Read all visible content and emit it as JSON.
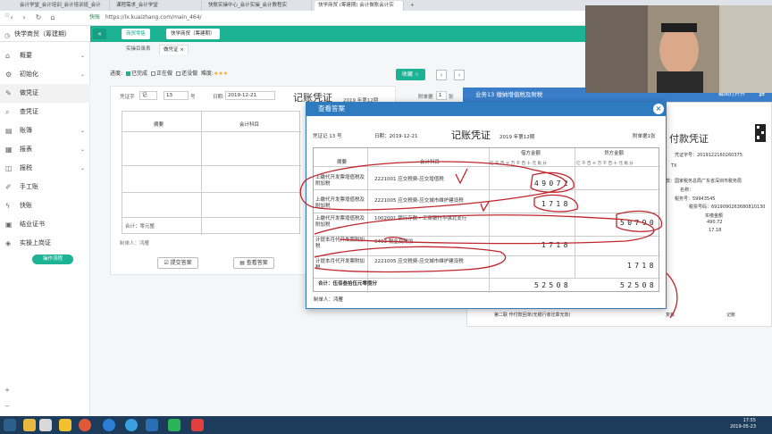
{
  "browser": {
    "tabs": [
      "会计学堂_会计培训_会计培训班_会计",
      "课程需求_会计学堂",
      "快账实操中心_会计实操_会计教程实",
      "快学商贸 (筹建期) 会计做账会计实",
      "+"
    ],
    "url_prefix": "快账",
    "url": "https://lx.kuaizhang.com/main_464/"
  },
  "header": {
    "logo": "快学商贸（筹建期）",
    "collapse": "«",
    "industry_btn": "商贸零售",
    "company_btn": "快学商贸（筹建期）",
    "right_link": "首页"
  },
  "sidebar": {
    "items": [
      {
        "label": "概要",
        "icon": "home-icon"
      },
      {
        "label": "初始化",
        "icon": "gear-icon"
      },
      {
        "label": "做凭证",
        "icon": "edit-icon"
      },
      {
        "label": "查凭证",
        "icon": "search-icon"
      },
      {
        "label": "账簿",
        "icon": "book-icon"
      },
      {
        "label": "报表",
        "icon": "chart-icon"
      },
      {
        "label": "报税",
        "icon": "tax-icon"
      },
      {
        "label": "手工账",
        "icon": "pen-icon"
      },
      {
        "label": "快账",
        "icon": "flash-icon"
      },
      {
        "label": "结业证书",
        "icon": "certificate-icon"
      },
      {
        "label": "实操上岗证",
        "icon": "badge-icon"
      }
    ],
    "operation_btn": "操作流程"
  },
  "subtabs": [
    "实操目录表",
    "做凭证",
    "×"
  ],
  "progress": {
    "label": "进度:",
    "done": "已完成",
    "doing": "正在做",
    "todo": "还没做",
    "difficulty": "难度:",
    "stars": "★★★"
  },
  "fav_btn": "收藏 ☆",
  "form": {
    "voucher_word_label": "凭证字",
    "voucher_word": "记",
    "voucher_no": "13",
    "no_label": "号",
    "date_label": "日期:",
    "date": "2019-12-21",
    "title": "记账凭证",
    "period": "2019 年第12期",
    "attach_label": "附单据",
    "attach_val": "1",
    "attach_unit": "张",
    "col_summary": "摘要",
    "col_account": "会计科目",
    "total": "合计：零元整",
    "maker": "制单人：鸿雁",
    "submit_btn": "提交答案",
    "view_btn": "查看答案"
  },
  "business": {
    "title": "业务13 缴纳增值税及附税",
    "right": "截图打开并"
  },
  "receipt": {
    "title": "付款凭证",
    "no": "凭证字号：2019122160260375",
    "l1": "TX",
    "l2": "款：国家税务总局广东省深圳市税务局",
    "l3": "名称：",
    "l4": "税务号：59943545",
    "l5": "税票号码：6919090263680810130",
    "l6": "实缴金额",
    "l7": "490.72",
    "l8": "17.18",
    "footer1": "第二联 作付款回单(无银行收讫章无效)",
    "footer2": "复核",
    "footer3": "记账"
  },
  "dialog": {
    "title": "查看答案",
    "close": "×",
    "voucher_no": "凭证记 13 号",
    "date": "日期：2019-12-21",
    "vtitle": "记账凭证",
    "period": "2019 年第12期",
    "attach": "附单据1张",
    "col_summary": "摘要",
    "col_account": "会计科目",
    "col_debit": "借方金额",
    "col_credit": "贷方金额",
    "digits": "亿 千 百 十 万 千 百 十 元 角 分",
    "rows": [
      {
        "summary": "上缴代开发票增值税及附加税",
        "account": "2221001 应交税费-应交增值税",
        "debit": "49072",
        "credit": ""
      },
      {
        "summary": "上缴代开发票增值税及附加税",
        "account": "2221005 应交税费-应交城市维护建设税",
        "debit": "1718",
        "credit": ""
      },
      {
        "summary": "上缴代开发票增值税及附加税",
        "account": "1002001 银行存款 - 工商银行华强北支行",
        "debit": "",
        "credit": "50790"
      },
      {
        "summary": "计提本月代开发票附加税",
        "account": "6403 税金及附加",
        "debit": "1718",
        "credit": ""
      },
      {
        "summary": "计提本月代开发票附加税",
        "account": "2221005 应交税费-应交城市维护建设税",
        "debit": "",
        "credit": "1718"
      }
    ],
    "total_label": "合计：伍佰叁拾伍元零捌分",
    "total_debit": "52508",
    "total_credit": "52508",
    "maker": "制单人：鸿雁"
  },
  "taskbar": {
    "time": "17:55",
    "date": "2019-05-23"
  }
}
